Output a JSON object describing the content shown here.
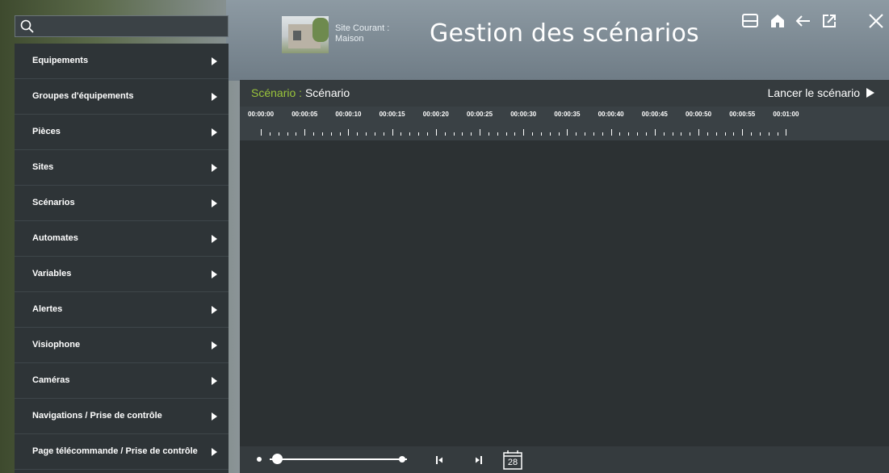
{
  "search": {
    "placeholder": "",
    "value": ""
  },
  "menu": {
    "items": [
      {
        "label": "Equipements"
      },
      {
        "label": "Groupes d'équipements"
      },
      {
        "label": "Pièces"
      },
      {
        "label": "Sites"
      },
      {
        "label": "Scénarios"
      },
      {
        "label": "Automates"
      },
      {
        "label": "Variables"
      },
      {
        "label": "Alertes"
      },
      {
        "label": "Visiophone"
      },
      {
        "label": "Caméras"
      },
      {
        "label": "Navigations / Prise de contrôle"
      },
      {
        "label": "Page télécommande / Prise de contrôle"
      }
    ]
  },
  "header": {
    "site_caption": "Site Courant :",
    "site_name": "Maison",
    "title": "Gestion des scénarios",
    "icons": [
      "tray-icon",
      "home-icon",
      "back-arrow-icon",
      "external-link-icon",
      "close-icon"
    ]
  },
  "scenario": {
    "key_label": "Scénario :",
    "name": "Scénario",
    "launch_label": "Lancer le scénario"
  },
  "timeline": {
    "labels": [
      "00:00:00",
      "00:00:05",
      "00:00:10",
      "00:00:15",
      "00:00:20",
      "00:00:25",
      "00:00:30",
      "00:00:35",
      "00:00:40",
      "00:00:45",
      "00:00:50",
      "00:00:55",
      "00:01:00"
    ]
  },
  "controls": {
    "zoom_level": 0.05,
    "calendar_day": "28",
    "icons": [
      "zoom-slider",
      "skip-to-start-icon",
      "skip-to-end-icon",
      "calendar-icon"
    ]
  },
  "colors": {
    "accent_green": "#9ac43b",
    "panel_bg": "#2c3133",
    "menu_bg": "#2e3437"
  }
}
